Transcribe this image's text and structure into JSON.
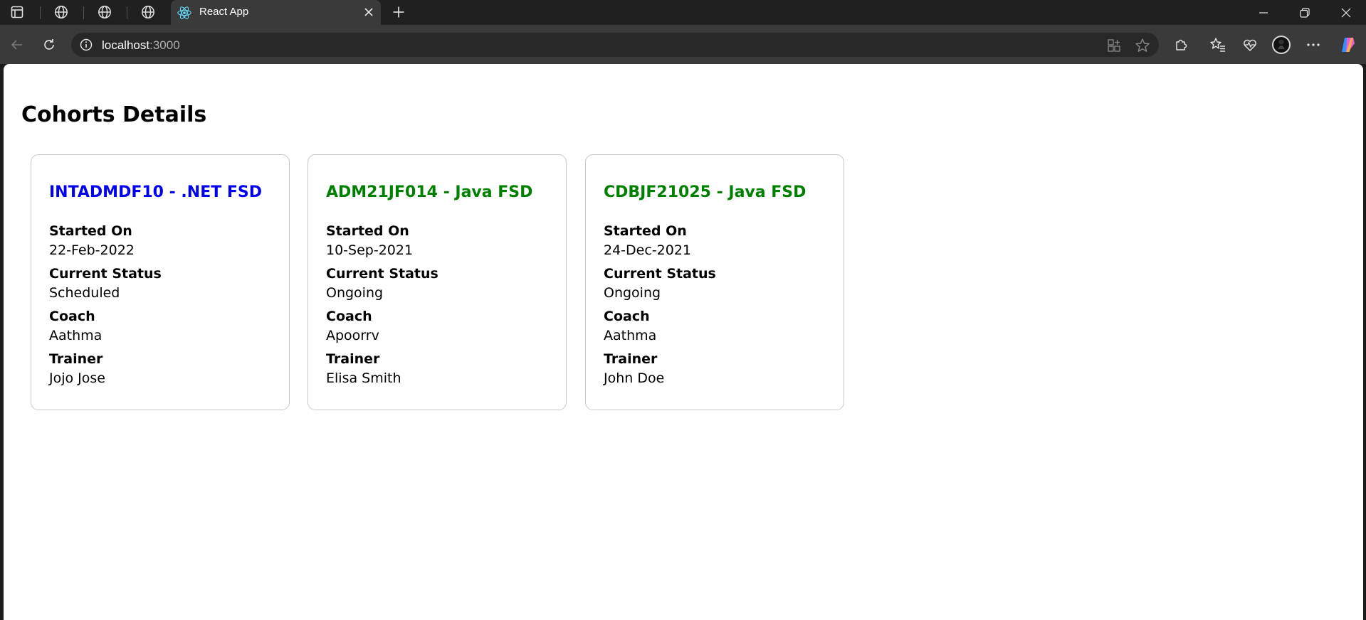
{
  "browser": {
    "active_tab_title": "React App",
    "url_host": "localhost",
    "url_port": ":3000"
  },
  "colors": {
    "scheduled_title": "#0000ee",
    "ongoing_title": "#008000"
  },
  "page": {
    "title": "Cohorts Details"
  },
  "labels": {
    "started_on": "Started On",
    "current_status": "Current Status",
    "coach": "Coach",
    "trainer": "Trainer"
  },
  "cohorts": [
    {
      "title": "INTADMDF10 - .NET FSD",
      "started_on": "22-Feb-2022",
      "status": "Scheduled",
      "coach": "Aathma",
      "trainer": "Jojo Jose",
      "title_color": "#0000ee"
    },
    {
      "title": "ADM21JF014 - Java FSD",
      "started_on": "10-Sep-2021",
      "status": "Ongoing",
      "coach": "Apoorrv",
      "trainer": "Elisa Smith",
      "title_color": "#008000"
    },
    {
      "title": "CDBJF21025 - Java FSD",
      "started_on": "24-Dec-2021",
      "status": "Ongoing",
      "coach": "Aathma",
      "trainer": "John Doe",
      "title_color": "#008000"
    }
  ]
}
